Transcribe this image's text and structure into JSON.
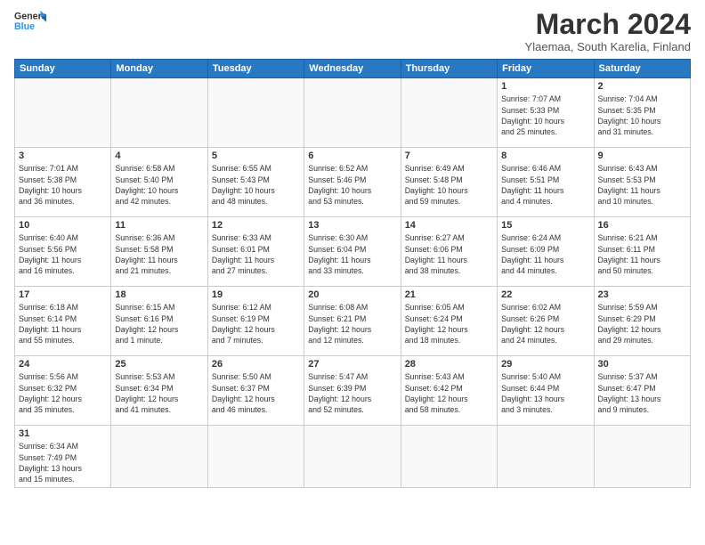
{
  "logo": {
    "general": "General",
    "blue": "Blue"
  },
  "header": {
    "title": "March 2024",
    "subtitle": "Ylaemaa, South Karelia, Finland"
  },
  "weekdays": [
    "Sunday",
    "Monday",
    "Tuesday",
    "Wednesday",
    "Thursday",
    "Friday",
    "Saturday"
  ],
  "weeks": [
    {
      "days": [
        {
          "num": "",
          "info": ""
        },
        {
          "num": "",
          "info": ""
        },
        {
          "num": "",
          "info": ""
        },
        {
          "num": "",
          "info": ""
        },
        {
          "num": "",
          "info": ""
        },
        {
          "num": "1",
          "info": "Sunrise: 7:07 AM\nSunset: 5:33 PM\nDaylight: 10 hours\nand 25 minutes."
        },
        {
          "num": "2",
          "info": "Sunrise: 7:04 AM\nSunset: 5:35 PM\nDaylight: 10 hours\nand 31 minutes."
        }
      ]
    },
    {
      "days": [
        {
          "num": "3",
          "info": "Sunrise: 7:01 AM\nSunset: 5:38 PM\nDaylight: 10 hours\nand 36 minutes."
        },
        {
          "num": "4",
          "info": "Sunrise: 6:58 AM\nSunset: 5:40 PM\nDaylight: 10 hours\nand 42 minutes."
        },
        {
          "num": "5",
          "info": "Sunrise: 6:55 AM\nSunset: 5:43 PM\nDaylight: 10 hours\nand 48 minutes."
        },
        {
          "num": "6",
          "info": "Sunrise: 6:52 AM\nSunset: 5:46 PM\nDaylight: 10 hours\nand 53 minutes."
        },
        {
          "num": "7",
          "info": "Sunrise: 6:49 AM\nSunset: 5:48 PM\nDaylight: 10 hours\nand 59 minutes."
        },
        {
          "num": "8",
          "info": "Sunrise: 6:46 AM\nSunset: 5:51 PM\nDaylight: 11 hours\nand 4 minutes."
        },
        {
          "num": "9",
          "info": "Sunrise: 6:43 AM\nSunset: 5:53 PM\nDaylight: 11 hours\nand 10 minutes."
        }
      ]
    },
    {
      "days": [
        {
          "num": "10",
          "info": "Sunrise: 6:40 AM\nSunset: 5:56 PM\nDaylight: 11 hours\nand 16 minutes."
        },
        {
          "num": "11",
          "info": "Sunrise: 6:36 AM\nSunset: 5:58 PM\nDaylight: 11 hours\nand 21 minutes."
        },
        {
          "num": "12",
          "info": "Sunrise: 6:33 AM\nSunset: 6:01 PM\nDaylight: 11 hours\nand 27 minutes."
        },
        {
          "num": "13",
          "info": "Sunrise: 6:30 AM\nSunset: 6:04 PM\nDaylight: 11 hours\nand 33 minutes."
        },
        {
          "num": "14",
          "info": "Sunrise: 6:27 AM\nSunset: 6:06 PM\nDaylight: 11 hours\nand 38 minutes."
        },
        {
          "num": "15",
          "info": "Sunrise: 6:24 AM\nSunset: 6:09 PM\nDaylight: 11 hours\nand 44 minutes."
        },
        {
          "num": "16",
          "info": "Sunrise: 6:21 AM\nSunset: 6:11 PM\nDaylight: 11 hours\nand 50 minutes."
        }
      ]
    },
    {
      "days": [
        {
          "num": "17",
          "info": "Sunrise: 6:18 AM\nSunset: 6:14 PM\nDaylight: 11 hours\nand 55 minutes."
        },
        {
          "num": "18",
          "info": "Sunrise: 6:15 AM\nSunset: 6:16 PM\nDaylight: 12 hours\nand 1 minute."
        },
        {
          "num": "19",
          "info": "Sunrise: 6:12 AM\nSunset: 6:19 PM\nDaylight: 12 hours\nand 7 minutes."
        },
        {
          "num": "20",
          "info": "Sunrise: 6:08 AM\nSunset: 6:21 PM\nDaylight: 12 hours\nand 12 minutes."
        },
        {
          "num": "21",
          "info": "Sunrise: 6:05 AM\nSunset: 6:24 PM\nDaylight: 12 hours\nand 18 minutes."
        },
        {
          "num": "22",
          "info": "Sunrise: 6:02 AM\nSunset: 6:26 PM\nDaylight: 12 hours\nand 24 minutes."
        },
        {
          "num": "23",
          "info": "Sunrise: 5:59 AM\nSunset: 6:29 PM\nDaylight: 12 hours\nand 29 minutes."
        }
      ]
    },
    {
      "days": [
        {
          "num": "24",
          "info": "Sunrise: 5:56 AM\nSunset: 6:32 PM\nDaylight: 12 hours\nand 35 minutes."
        },
        {
          "num": "25",
          "info": "Sunrise: 5:53 AM\nSunset: 6:34 PM\nDaylight: 12 hours\nand 41 minutes."
        },
        {
          "num": "26",
          "info": "Sunrise: 5:50 AM\nSunset: 6:37 PM\nDaylight: 12 hours\nand 46 minutes."
        },
        {
          "num": "27",
          "info": "Sunrise: 5:47 AM\nSunset: 6:39 PM\nDaylight: 12 hours\nand 52 minutes."
        },
        {
          "num": "28",
          "info": "Sunrise: 5:43 AM\nSunset: 6:42 PM\nDaylight: 12 hours\nand 58 minutes."
        },
        {
          "num": "29",
          "info": "Sunrise: 5:40 AM\nSunset: 6:44 PM\nDaylight: 13 hours\nand 3 minutes."
        },
        {
          "num": "30",
          "info": "Sunrise: 5:37 AM\nSunset: 6:47 PM\nDaylight: 13 hours\nand 9 minutes."
        }
      ]
    },
    {
      "days": [
        {
          "num": "31",
          "info": "Sunrise: 6:34 AM\nSunset: 7:49 PM\nDaylight: 13 hours\nand 15 minutes."
        },
        {
          "num": "",
          "info": ""
        },
        {
          "num": "",
          "info": ""
        },
        {
          "num": "",
          "info": ""
        },
        {
          "num": "",
          "info": ""
        },
        {
          "num": "",
          "info": ""
        },
        {
          "num": "",
          "info": ""
        }
      ]
    }
  ]
}
